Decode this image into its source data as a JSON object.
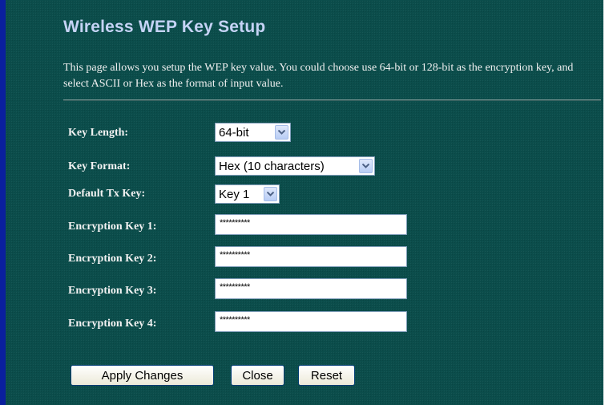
{
  "page": {
    "title": "Wireless WEP Key Setup",
    "description": "This page allows you setup the WEP key value. You could choose use 64-bit or 128-bit as the encryption key, and select ASCII or Hex as the format of input value."
  },
  "form": {
    "key_length": {
      "label": "Key Length:",
      "value": "64-bit"
    },
    "key_format": {
      "label": "Key Format:",
      "value": "Hex (10 characters)"
    },
    "default_tx_key": {
      "label": "Default Tx Key:",
      "value": "Key 1"
    },
    "encryption_keys": [
      {
        "label": "Encryption Key 1:",
        "value": "**********"
      },
      {
        "label": "Encryption Key 2:",
        "value": "**********"
      },
      {
        "label": "Encryption Key 3:",
        "value": "**********"
      },
      {
        "label": "Encryption Key 4:",
        "value": "**********"
      }
    ]
  },
  "buttons": {
    "apply": "Apply Changes",
    "close": "Close",
    "reset": "Reset"
  },
  "icons": {
    "dropdown": "chevron-down-icon"
  },
  "colors": {
    "panel_background": "#0b4d4b",
    "title": "#c5d3f5",
    "left_edge": "#0a1f9e"
  }
}
